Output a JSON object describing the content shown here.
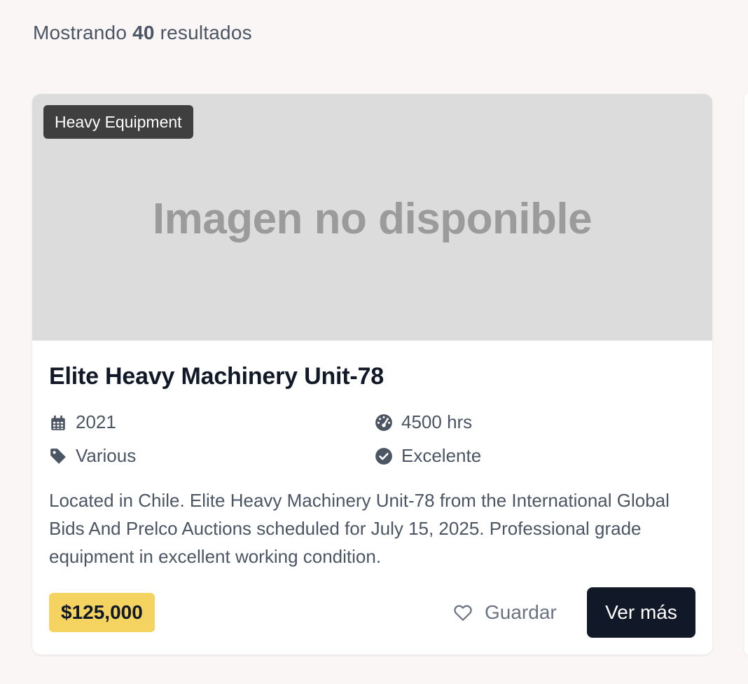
{
  "results": {
    "prefix": "Mostrando",
    "count": "40",
    "suffix": "resultados"
  },
  "listing": {
    "category": "Heavy Equipment",
    "image_placeholder": "Imagen no disponible",
    "title": "Elite Heavy Machinery Unit-78",
    "specs": {
      "year": "2021",
      "hours": "4500 hrs",
      "brand": "Various",
      "condition": "Excelente"
    },
    "description": "Located in Chile. Elite Heavy Machinery Unit-78 from the International Global Bids And Prelco Auctions scheduled for July 15, 2025. Professional grade equipment in excellent working condition.",
    "price": "$125,000",
    "save_label": "Guardar",
    "more_label": "Ver más"
  },
  "icons": {
    "year": "calendar-icon",
    "hours": "gauge-icon",
    "brand": "tag-icon",
    "condition": "check-circle-icon",
    "save": "heart-icon"
  },
  "colors": {
    "background": "#f9f6f5",
    "price_badge": "#f4d361",
    "primary_button": "#111827",
    "category_badge": "#3f3f3f",
    "image_placeholder_bg": "#dcdcdc"
  }
}
